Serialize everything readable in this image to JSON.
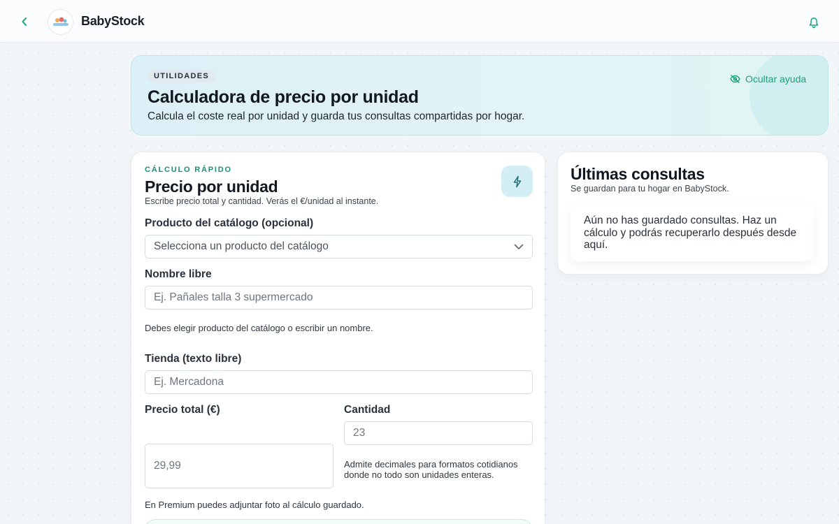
{
  "app": {
    "brand": "BabyStock",
    "logo_text": "BabyStock"
  },
  "hero": {
    "chip": "UTILIDADES",
    "title": "Calculadora de precio por unidad",
    "subtitle": "Calcula el coste real por unidad y guarda tus consultas compartidas por hogar.",
    "hide_help_label": "Ocultar ayuda"
  },
  "calculator": {
    "eyebrow": "CÁLCULO RÁPIDO",
    "title": "Precio por unidad",
    "subtitle": "Escribe precio total y cantidad. Verás el €/unidad al instante.",
    "catalog_label": "Producto del catálogo (opcional)",
    "catalog_placeholder": "Selecciona un producto del catálogo",
    "name_label": "Nombre libre",
    "name_placeholder": "Ej. Pañales talla 3 supermercado",
    "name_hint": "Debes elegir producto del catálogo o escribir un nombre.",
    "store_label": "Tienda (texto libre)",
    "store_placeholder": "Ej. Mercadona",
    "price_label": "Precio total (€)",
    "price_placeholder": "29,99",
    "qty_label": "Cantidad",
    "qty_placeholder": "23",
    "qty_hint": "Admite decimales para formatos cotidianos donde no todo son unidades enteras.",
    "premium_hint": "En Premium puedes adjuntar foto al cálculo guardado."
  },
  "history": {
    "title": "Últimas consultas",
    "subtitle": "Se guardan para tu hogar en BabyStock.",
    "empty_message": "Aún no has guardado consultas. Haz un cálculo y podrás recuperarlo después desde aquí."
  },
  "colors": {
    "accent": "#17a37a",
    "hero_bg": "#dcf0f7",
    "bolt_bg": "#d3eff3",
    "text": "#121820"
  },
  "icons": {
    "back": "chevron-left-icon",
    "notifications": "bell-icon",
    "hide_help": "eye-off-icon",
    "quick_calc": "lightning-bolt-icon",
    "select": "chevron-down-icon"
  }
}
